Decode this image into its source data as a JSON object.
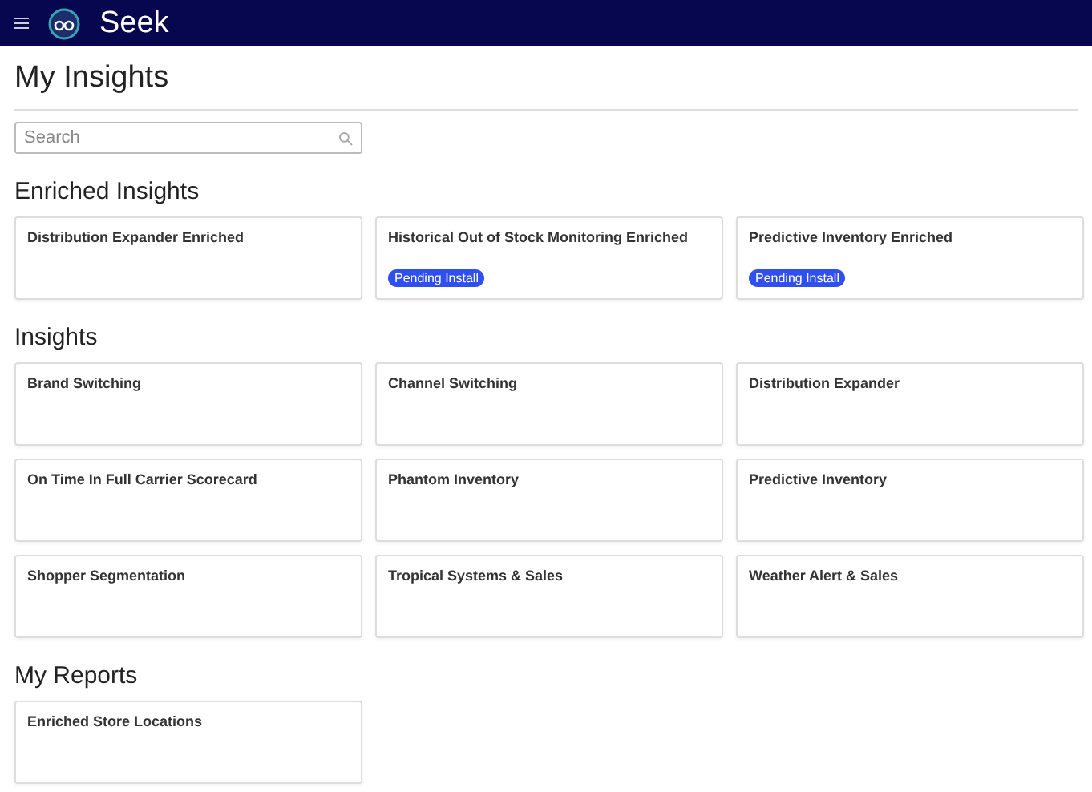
{
  "header": {
    "brand": "Seek"
  },
  "page": {
    "title": "My Insights"
  },
  "search": {
    "placeholder": "Search"
  },
  "sections": [
    {
      "title": "Enriched Insights",
      "cards": [
        {
          "title": "Distribution Expander Enriched"
        },
        {
          "title": "Historical Out of Stock Monitoring Enriched",
          "badge": "Pending Install"
        },
        {
          "title": "Predictive Inventory Enriched",
          "badge": "Pending Install"
        }
      ]
    },
    {
      "title": "Insights",
      "cards": [
        {
          "title": "Brand Switching"
        },
        {
          "title": "Channel Switching"
        },
        {
          "title": "Distribution Expander"
        },
        {
          "title": "On Time In Full Carrier Scorecard"
        },
        {
          "title": "Phantom Inventory"
        },
        {
          "title": "Predictive Inventory"
        },
        {
          "title": "Shopper Segmentation"
        },
        {
          "title": "Tropical Systems & Sales"
        },
        {
          "title": "Weather Alert & Sales"
        }
      ]
    },
    {
      "title": "My Reports",
      "cards": [
        {
          "title": "Enriched Store Locations"
        }
      ]
    }
  ]
}
